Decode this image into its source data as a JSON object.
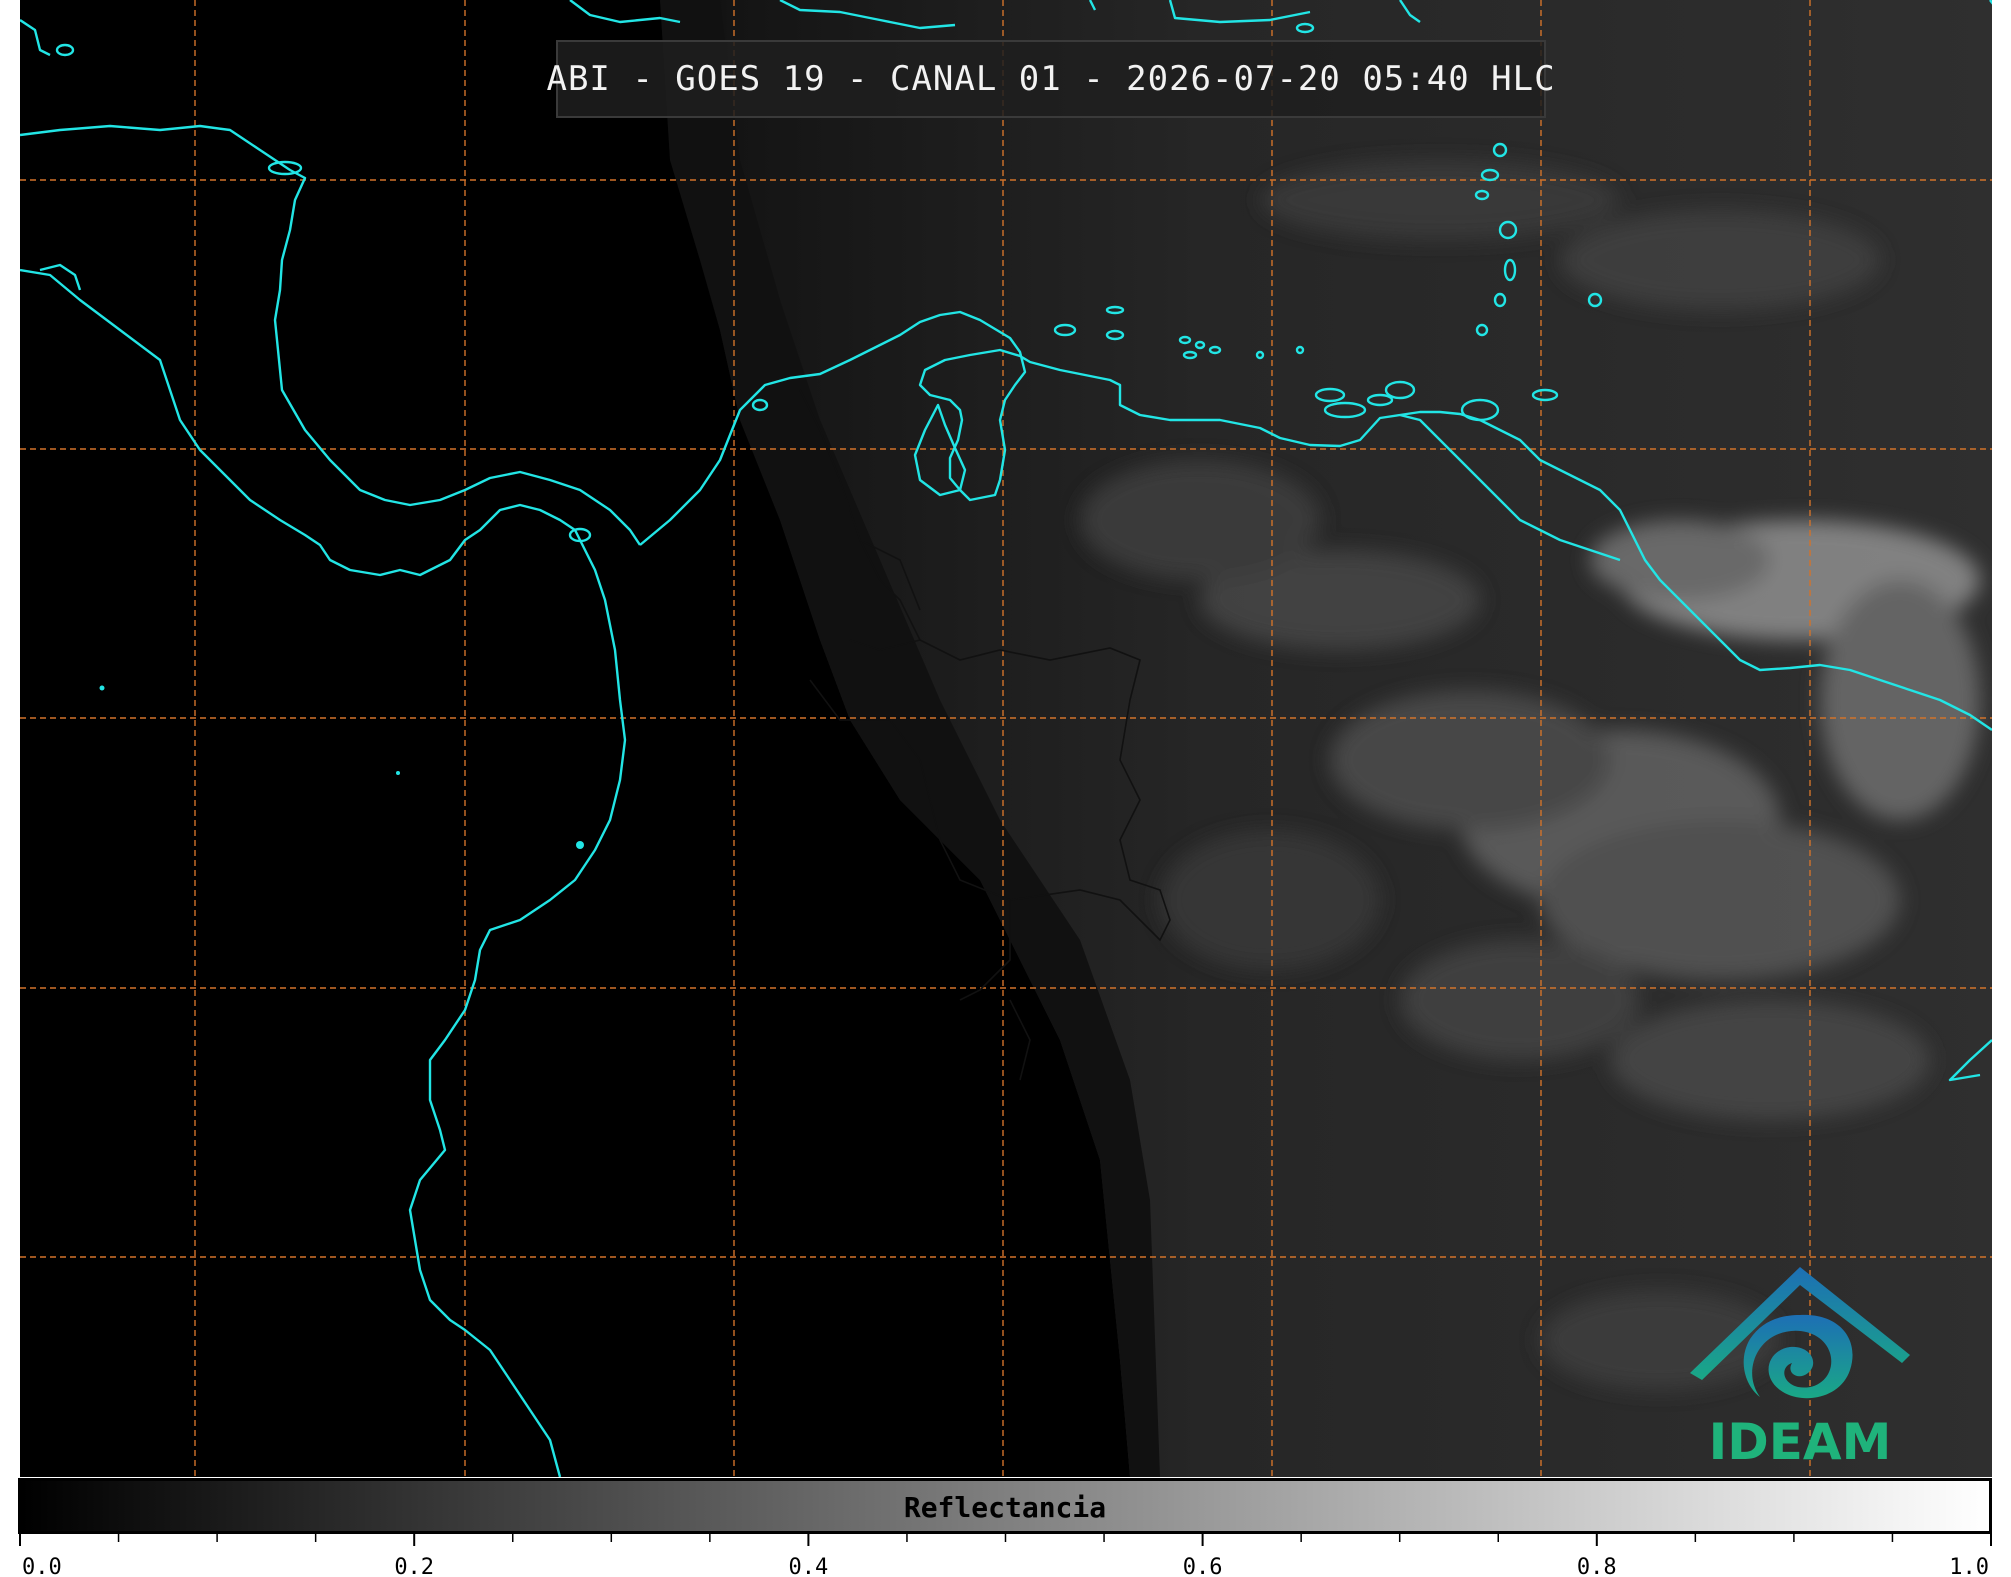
{
  "title": "ABI - GOES 19 - CANAL 01 - 2026-07-20 05:40 HLC",
  "map": {
    "grid_color": "#d2732a",
    "coastline_color": "#22e5e5",
    "border_color": "#111111",
    "background_night": "#000000",
    "background_day": "#2f2f2f"
  },
  "logo": {
    "text": "IDEAM",
    "colors": {
      "mountain": "#1d6fb5",
      "swirl": "#1aa886",
      "text": "#1fb37b"
    }
  },
  "colorbar": {
    "label": "Reflectancia",
    "range": [
      0.0,
      1.0
    ],
    "tick_labels": [
      "0.0",
      "0.2",
      "0.4",
      "0.6",
      "0.8",
      "1.0"
    ],
    "color_start": "#000000",
    "color_end": "#ffffff"
  }
}
